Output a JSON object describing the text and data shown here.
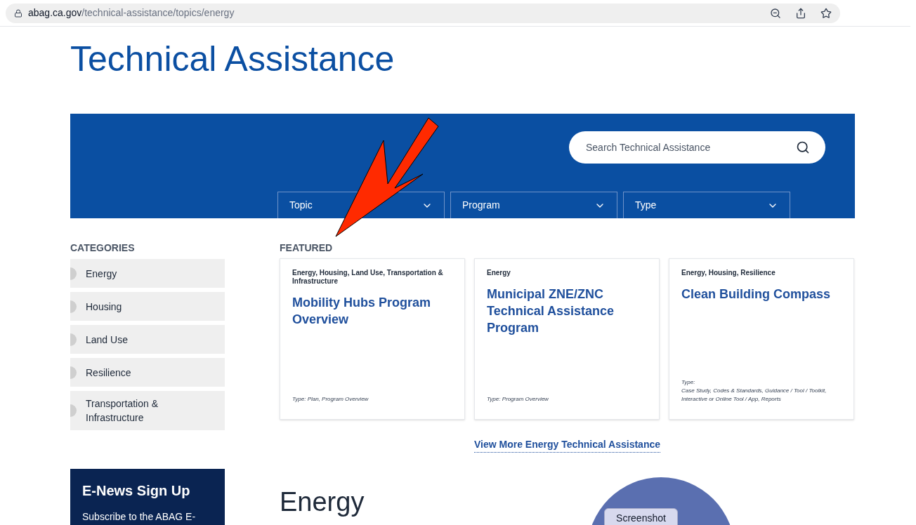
{
  "browser": {
    "url_host": "abag.ca.gov",
    "url_path": "/technical-assistance/topics/energy"
  },
  "page_title": "Technical Assistance",
  "search": {
    "placeholder": "Search Technical Assistance"
  },
  "filters": [
    {
      "label": "Topic"
    },
    {
      "label": "Program"
    },
    {
      "label": "Type"
    }
  ],
  "categories": {
    "heading": "CATEGORIES",
    "items": [
      {
        "label": "Energy"
      },
      {
        "label": "Housing"
      },
      {
        "label": "Land Use"
      },
      {
        "label": "Resilience"
      },
      {
        "label": "Transportation & Infrastructure"
      }
    ]
  },
  "featured": {
    "heading": "FEATURED",
    "cards": [
      {
        "topics": "Energy, Housing, Land Use, Transportation & Infrastructure",
        "title": "Mobility Hubs Program Overview",
        "type_label": "Type:",
        "type": "Plan, Program Overview",
        "type_block": false
      },
      {
        "topics": "Energy",
        "title": "Municipal ZNE/ZNC Technical Assistance Program",
        "type_label": "Type:",
        "type": "Program Overview",
        "type_block": false
      },
      {
        "topics": "Energy, Housing, Resilience",
        "title": "Clean Building Compass",
        "type_label": "Type:",
        "type": "Case Study, Codes & Standards, Guidance / Tool / Toolkit, Interactive or Online Tool / App, Reports",
        "type_block": true
      }
    ],
    "more_link": "View More Energy Technical Assistance"
  },
  "enews": {
    "title": "E-News Sign Up",
    "text": "Subscribe to the ABAG E-"
  },
  "section_heading": "Energy",
  "screenshot_tag": "Screenshot"
}
